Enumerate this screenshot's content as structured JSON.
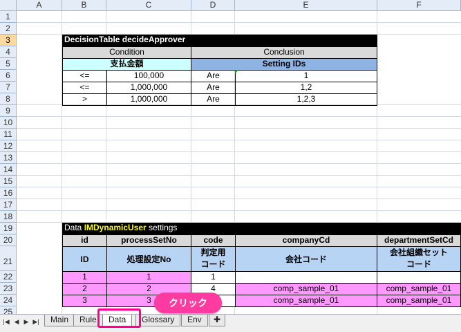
{
  "columns": [
    "A",
    "B",
    "C",
    "D",
    "E",
    "F"
  ],
  "rows": [
    "1",
    "2",
    "3",
    "4",
    "5",
    "6",
    "7",
    "8",
    "9",
    "10",
    "11",
    "12",
    "13",
    "14",
    "15",
    "16",
    "17",
    "18",
    "19",
    "20",
    "21",
    "22",
    "23",
    "24",
    "25"
  ],
  "decision": {
    "title": "DecisionTable decideApprover",
    "condition_label": "Condition",
    "conclusion_label": "Conclusion",
    "field_label": "支払金額",
    "setting_label": "Setting IDs",
    "rows": [
      {
        "op": "<=",
        "amount": "100,000",
        "are": "Are",
        "ids": "1"
      },
      {
        "op": "<=",
        "amount": "1,000,000",
        "are": "Are",
        "ids": "1,2"
      },
      {
        "op": ">",
        "amount": "1,000,000",
        "are": "Are",
        "ids": "1,2,3"
      }
    ]
  },
  "data_table": {
    "title_prefix": "Data ",
    "title_name": "IMDynamicUser",
    "title_suffix": " settings",
    "headers": [
      "id",
      "processSetNo",
      "code",
      "companyCd",
      "departmentSetCd"
    ],
    "jp_headers": [
      "ID",
      "処理設定No",
      "判定用\nコード",
      "会社コード",
      "会社組織セット\nコード"
    ],
    "rows": [
      [
        "1",
        "1",
        "1",
        "",
        ""
      ],
      [
        "2",
        "2",
        "4",
        "comp_sample_01",
        "comp_sample_01"
      ],
      [
        "3",
        "3",
        "",
        "comp_sample_01",
        "comp_sample_01"
      ]
    ]
  },
  "tabs": [
    "Main",
    "Rule",
    "Data",
    "Glossary",
    "Env"
  ],
  "active_tab": "Data",
  "callout_text": "クリック",
  "colors": {
    "callout": "#ff3aa0",
    "highlight": "#ff0090"
  }
}
